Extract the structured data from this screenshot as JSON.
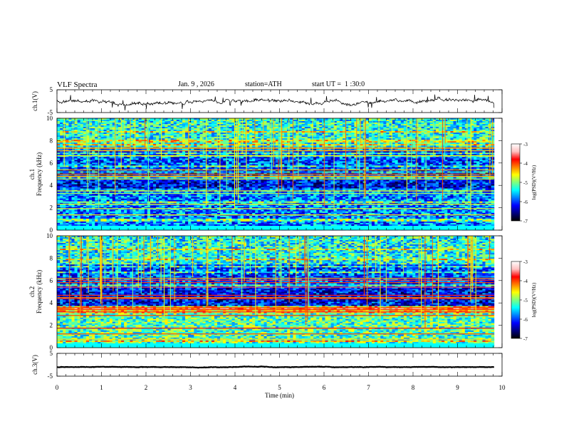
{
  "header": {
    "title": "VLF Spectra",
    "date": "Jan. 9 , 2026",
    "station": "station=ATH",
    "start_ut": "start UT =  1 :30:0"
  },
  "colors": {
    "colormap": [
      "#000000",
      "#00007f",
      "#0000ff",
      "#007fff",
      "#00ffff",
      "#7fff7f",
      "#ffff00",
      "#ff7f00",
      "#ff0000",
      "#ffc0c0",
      "#ffffff"
    ],
    "waveform": "#000000"
  },
  "chart_data": [
    {
      "type": "line",
      "panel": "ch1-waveform",
      "ylabel": "ch.1(V)",
      "ylim": [
        -5,
        5
      ],
      "yticks": [
        "5",
        "-5"
      ],
      "xlim": [
        0,
        10
      ],
      "approx_level": 0,
      "noise_amplitude": 1
    },
    {
      "type": "heatmap",
      "panel": "ch1-spectrogram",
      "ylabel_lines": [
        "ch.1",
        "Frequency (kHz)"
      ],
      "ylim": [
        0,
        10
      ],
      "yticks": [
        "0",
        "2",
        "4",
        "6",
        "8",
        "10"
      ],
      "xlim": [
        0,
        10.0
      ],
      "data_extent_x": 9.82,
      "colorbar": {
        "label": "log(PSD)(V²/Hz)",
        "range": [
          -7,
          -3
        ],
        "ticks": [
          "-3",
          "-4",
          "-5",
          "-6",
          "-7"
        ]
      }
    },
    {
      "type": "heatmap",
      "panel": "ch2-spectrogram",
      "ylabel_lines": [
        "ch.2",
        "Frequency (kHz)"
      ],
      "ylim": [
        0,
        10
      ],
      "yticks": [
        "0",
        "2",
        "4",
        "6",
        "8",
        "10"
      ],
      "xlim": [
        0,
        10.0
      ],
      "data_extent_x": 9.82,
      "colorbar": {
        "label": "log(PSD)(V²/Hz)",
        "range": [
          -7,
          -3
        ],
        "ticks": [
          "-3",
          "-4",
          "-5",
          "-6",
          "-7"
        ]
      }
    },
    {
      "type": "line",
      "panel": "ch3-waveform",
      "ylabel": "ch.3(V)",
      "ylim": [
        -5,
        5
      ],
      "yticks": [
        "5",
        "-5"
      ],
      "xlim": [
        0,
        10
      ],
      "approx_level": -1,
      "noise_amplitude": 0.15
    }
  ],
  "xaxis": {
    "label": "Time (min)",
    "ticks": [
      "0",
      "1",
      "2",
      "3",
      "4",
      "5",
      "6",
      "7",
      "8",
      "9",
      "10"
    ]
  }
}
